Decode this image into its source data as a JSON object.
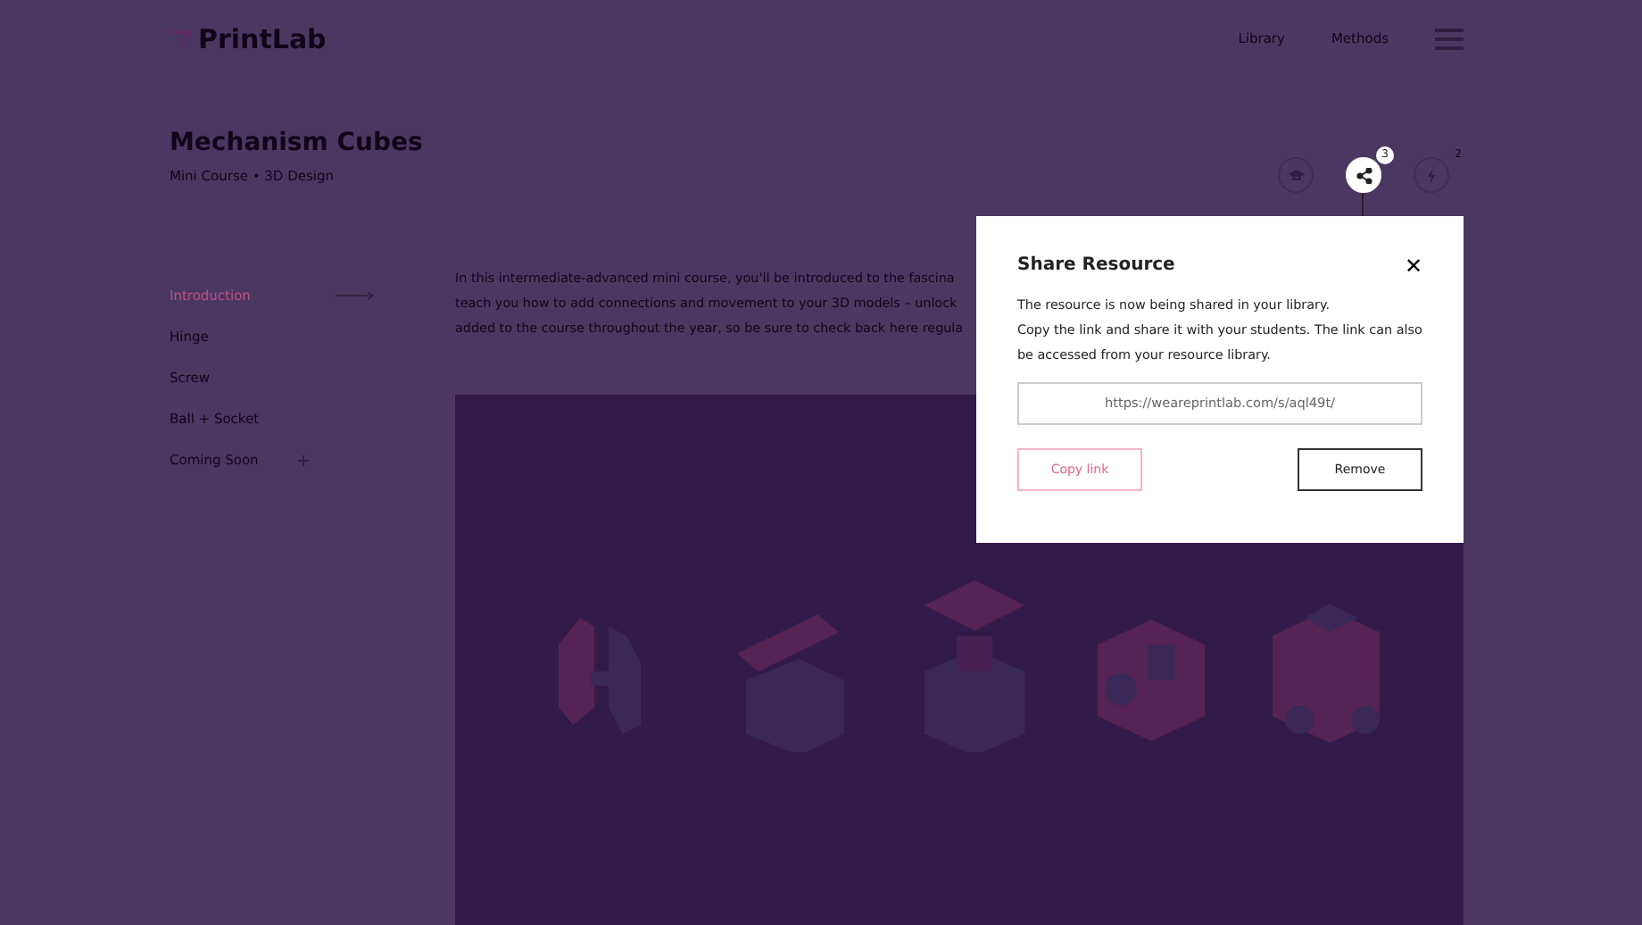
{
  "header": {
    "logo": "PrintLab",
    "nav": [
      "Library",
      "Methods"
    ]
  },
  "course": {
    "title": "Mechanism Cubes",
    "subtitle": "Mini Course • 3D Design"
  },
  "actions": [
    {
      "kind": "cap",
      "selected": false
    },
    {
      "kind": "share",
      "badge": "3",
      "selected": true
    },
    {
      "kind": "bolt",
      "badge": "2",
      "selected": false
    }
  ],
  "sidebar": {
    "items": [
      {
        "label": "Introduction",
        "selected": true,
        "kind": "arrow"
      },
      {
        "label": "Hinge",
        "selected": false,
        "kind": "plain"
      },
      {
        "label": "Screw",
        "selected": false,
        "kind": "plain"
      },
      {
        "label": "Ball + Socket",
        "selected": false,
        "kind": "plain"
      },
      {
        "label": "Coming Soon",
        "selected": false,
        "kind": "plus"
      }
    ]
  },
  "intro": [
    "In this intermediate-advanced mini course, you'll be introduced to the fascina",
    "teach you how to add connections and movement to your 3D models – unlock",
    "added to the course throughout the year, so be sure to check back here regula"
  ],
  "modal": {
    "title": "Share Resource",
    "close": "✕",
    "lines": [
      "The resource is now being shared in your library.",
      "Copy the link and share it with your students. The link can also be accessed from your resource library."
    ],
    "link": "https://weareprintlab.com/s/aql49t/",
    "buttons": [
      {
        "label": "Copy link",
        "kind": "outline-pink"
      },
      {
        "label": "Remove",
        "kind": "outline-dark"
      }
    ]
  }
}
